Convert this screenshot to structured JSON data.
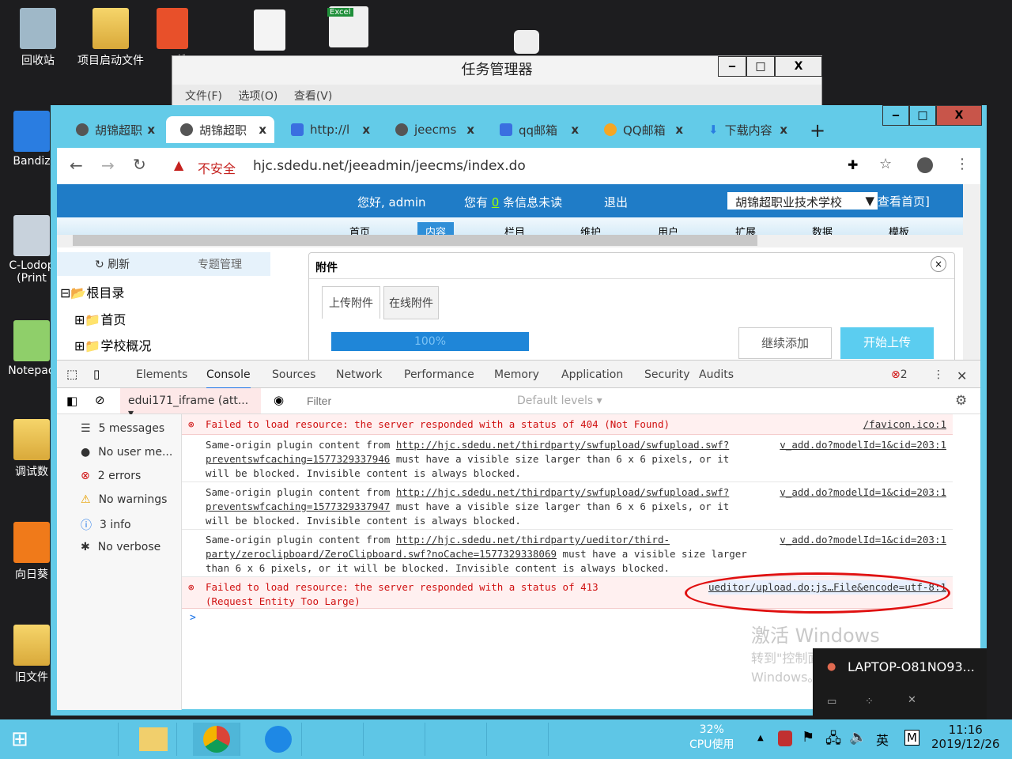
{
  "desktop": {
    "icons_top": [
      "回收站",
      "项目启动文件",
      "搜",
      "",
      ""
    ],
    "icons_left": [
      "Bandiz",
      "C-Lodop (Print",
      "Notepad",
      "调试数",
      "向日葵",
      "旧文件"
    ],
    "excel_badge": "Excel"
  },
  "task_manager": {
    "title": "任务管理器",
    "menu": [
      "文件(F)",
      "选项(O)",
      "查看(V)"
    ],
    "controls": [
      "‒",
      "□",
      "X"
    ]
  },
  "browser": {
    "tabs": [
      {
        "label": "胡锦超职",
        "active": false
      },
      {
        "label": "胡锦超职",
        "active": true
      },
      {
        "label": "http://l",
        "active": false
      },
      {
        "label": "jeecms",
        "active": false
      },
      {
        "label": "qq邮箱",
        "active": false
      },
      {
        "label": "QQ邮箱",
        "active": false
      },
      {
        "label": "下载内容",
        "active": false
      }
    ],
    "new_tab": "+",
    "window_controls": [
      "‒",
      "□",
      "X"
    ],
    "security_label": "不安全",
    "url": "hjc.sdedu.net/jeeadmin/jeecms/index.do"
  },
  "page": {
    "greeting": "您好, admin",
    "msg_prefix": "您有",
    "msg_count": "0",
    "msg_suffix": "条信息未读",
    "logout": "退出",
    "site_select": "胡锦超职业技术学校",
    "view_home": "查看首页]",
    "nav": [
      "首页",
      "内容",
      "栏目",
      "维护",
      "用户",
      "扩展",
      "数据",
      "模板"
    ],
    "tree_toolbar": {
      "refresh": "刷新",
      "topic": "专题管理"
    },
    "tree": [
      "根目录",
      "首页",
      "学校概况"
    ],
    "dialog": {
      "title": "附件",
      "tabs": [
        "上传附件",
        "在线附件"
      ],
      "progress_percent": 100,
      "progress_label": "100%",
      "continue_btn": "继续添加",
      "start_btn": "开始上传"
    }
  },
  "devtools": {
    "tabs": [
      "Elements",
      "Console",
      "Sources",
      "Network",
      "Performance",
      "Memory",
      "Application",
      "Security",
      "Audits"
    ],
    "active_tab": "Console",
    "error_count": "2",
    "context": "edui171_iframe (att...",
    "filter_placeholder": "Filter",
    "levels": "Default levels ▾",
    "sidebar": [
      "5 messages",
      "No user me...",
      "2 errors",
      "No warnings",
      "3 info",
      "No verbose"
    ],
    "messages": [
      {
        "type": "error",
        "text": "Failed to load resource: the server responded with a status of 404 (Not Found)",
        "source": "/favicon.ico:1"
      },
      {
        "type": "info",
        "pre": "Same-origin plugin content from ",
        "link": "http://hjc.sdedu.net/thirdparty/swfupload/swfupload.swf?preventswfcaching=1577329337946",
        "post": " must have a visible size larger than 6 x 6 pixels, or it will be blocked. Invisible content is always blocked.",
        "source": "v_add.do?modelId=1&cid=203:1"
      },
      {
        "type": "info",
        "pre": "Same-origin plugin content from ",
        "link": "http://hjc.sdedu.net/thirdparty/swfupload/swfupload.swf?preventswfcaching=1577329337947",
        "post": " must have a visible size larger than 6 x 6 pixels, or it will be blocked. Invisible content is always blocked.",
        "source": "v_add.do?modelId=1&cid=203:1"
      },
      {
        "type": "info",
        "pre": "Same-origin plugin content from ",
        "link": "http://hjc.sdedu.net/thirdparty/ueditor/third-party/zeroclipboard/ZeroClipboard.swf?noCache=1577329338069",
        "post": " must have a visible size larger than 6 x 6 pixels, or it will be blocked. Invisible content is always blocked.",
        "source": "v_add.do?modelId=1&cid=203:1"
      },
      {
        "type": "error",
        "text": "Failed to load resource: the server responded with a status of 413 (Request Entity Too Large)",
        "source": "ueditor/upload.do;js…File&encode=utf-8:1"
      }
    ],
    "prompt": ">"
  },
  "watermark": {
    "title": "激活 Windows",
    "line1": "转到\"控制面板\"中的\"系统\"以激活",
    "line2": "Windows。"
  },
  "remote_popup": {
    "name": "LAPTOP-O81NO93..."
  },
  "taskbar": {
    "cpu_percent": "32%",
    "cpu_label": "CPU使用",
    "ime": "英",
    "ime2": "M",
    "time": "11:16",
    "date": "2019/12/26"
  },
  "colors": {
    "frame": "#63cbe8",
    "error": "#d01010",
    "highlight_circle": "#e01010",
    "page_header": "#1f7cc7"
  }
}
